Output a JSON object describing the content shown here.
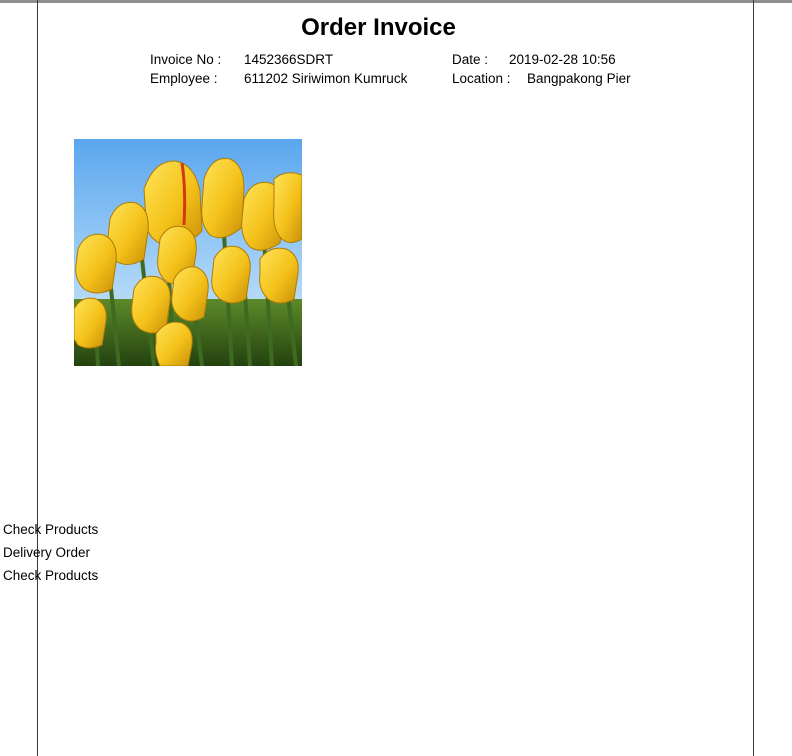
{
  "invoice": {
    "title": "Order Invoice",
    "invoice_no_label": "Invoice No :",
    "invoice_no_value": "1452366SDRT",
    "employee_label": "Employee :",
    "employee_value": "611202  Siriwimon Kumruck",
    "date_label": "Date :",
    "date_value": "2019-02-28  10:56",
    "location_label": "Location :",
    "location_value": "Bangpakong Pier"
  },
  "image": {
    "subject": "yellow tulips against blue sky"
  },
  "side_list": {
    "items": [
      "Check Products",
      "Delivery Order",
      "Check Products"
    ]
  },
  "colors": {
    "rule": "#8f8f8f",
    "sky": "#6fb1f0",
    "petal": "#f4c21a",
    "stem": "#3e6b1f"
  }
}
